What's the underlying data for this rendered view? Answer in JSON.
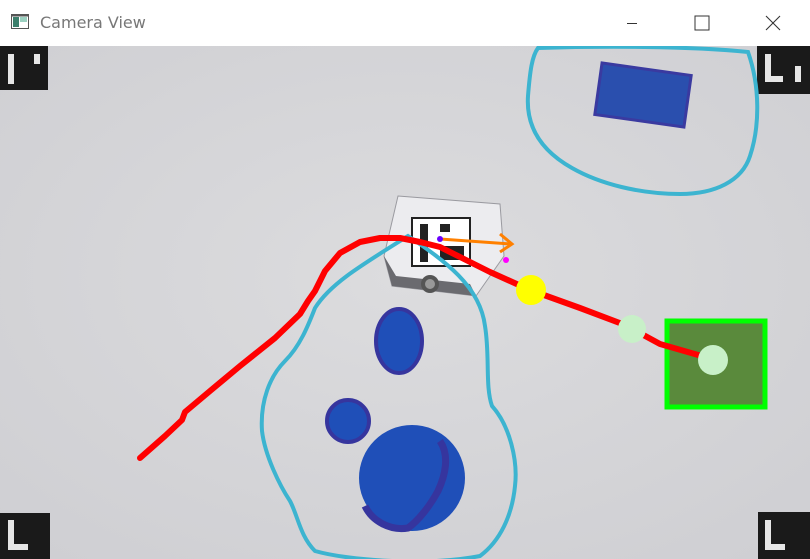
{
  "window": {
    "title": "Camera View",
    "controls": [
      "minimize-icon",
      "maximize-icon",
      "close-icon"
    ]
  },
  "colors": {
    "background": "#d9d9dc",
    "path": "#ff0000",
    "zone_outline": "#3cb4d0",
    "obstacle": "#2d4dbf",
    "goal_outline": "#00ff00",
    "goal_fill": "#5a8a3c",
    "waypoint": "#c8f0c8",
    "current_target": "#ffff00",
    "heading_arrow": "#ff8000"
  },
  "icons": {
    "app": "camera-window-icon",
    "markers": "fiducial-corner-marker"
  }
}
